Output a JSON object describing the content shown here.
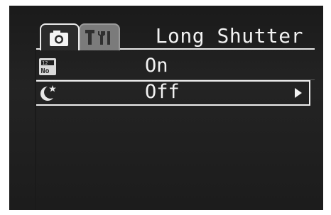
{
  "menu": {
    "tabs": [
      {
        "icon": "camera-icon",
        "active": true
      },
      {
        "icon": "tools-icon",
        "active": false
      }
    ],
    "title": "Long Shutter",
    "rows": [
      {
        "icon": "file-number-icon",
        "value": "On",
        "selected": false
      },
      {
        "icon": "night-scene-icon",
        "value": "Off",
        "selected": true,
        "has_submenu": true
      }
    ]
  },
  "colors": {
    "lcd_background": "#1f1f1f",
    "text": "#f2f2f2",
    "active_tab_border": "#e9e9e9",
    "inactive_tab": "#7b7b7b"
  }
}
